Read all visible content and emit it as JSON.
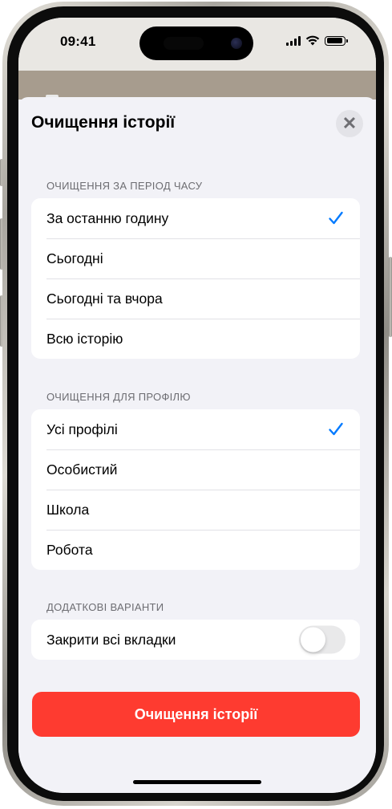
{
  "status_bar": {
    "time": "09:41"
  },
  "sheet": {
    "title": "Очищення історії",
    "close_label": "✕"
  },
  "time_range": {
    "header": "ОЧИЩЕННЯ ЗА ПЕРІОД ЧАСУ",
    "items": [
      {
        "label": "За останню годину",
        "selected": true
      },
      {
        "label": "Сьогодні",
        "selected": false
      },
      {
        "label": "Сьогодні та вчора",
        "selected": false
      },
      {
        "label": "Всю історію",
        "selected": false
      }
    ]
  },
  "profiles": {
    "header": "ОЧИЩЕННЯ ДЛЯ ПРОФІЛЮ",
    "items": [
      {
        "label": "Усі профілі",
        "selected": true
      },
      {
        "label": "Особистий",
        "selected": false
      },
      {
        "label": "Школа",
        "selected": false
      },
      {
        "label": "Робота",
        "selected": false
      }
    ]
  },
  "extra": {
    "header": "ДОДАТКОВІ ВАРІАНТИ",
    "close_tabs_label": "Закрити всі вкладки",
    "close_tabs_on": false
  },
  "action": {
    "clear_button": "Очищення історії"
  },
  "colors": {
    "accent": "#007aff",
    "destructive": "#fe3b30",
    "background": "#f2f2f7",
    "toggle_off": "#e9e9ea"
  }
}
